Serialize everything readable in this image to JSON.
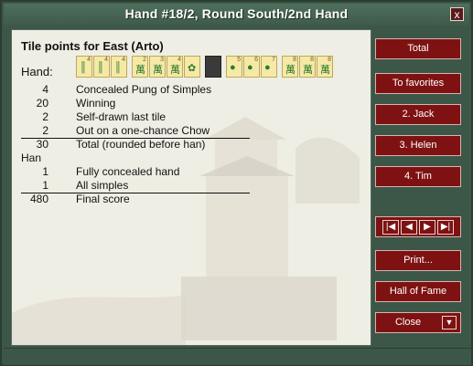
{
  "window": {
    "title": "Hand #18/2, Round South/2nd Hand",
    "close_glyph": "x"
  },
  "content": {
    "heading": "Tile points for East (Arto)",
    "hand_label": "Hand:",
    "tiles": [
      {
        "n": "4",
        "icon": "bamboo"
      },
      {
        "n": "4",
        "icon": "bamboo"
      },
      {
        "n": "4",
        "icon": "bamboo"
      },
      {
        "n": "2",
        "icon": "char"
      },
      {
        "n": "3",
        "icon": "char"
      },
      {
        "n": "4",
        "icon": "char"
      },
      {
        "n": "",
        "icon": "flower"
      },
      {
        "n": "",
        "icon": "dark"
      },
      {
        "n": "5",
        "icon": "circles"
      },
      {
        "n": "6",
        "icon": "circles"
      },
      {
        "n": "7",
        "icon": "circles"
      },
      {
        "n": "8",
        "icon": "char"
      },
      {
        "n": "8",
        "icon": "char"
      },
      {
        "n": "8",
        "icon": "char"
      }
    ],
    "scoring": [
      {
        "points": "4",
        "desc": "Concealed Pung of Simples"
      },
      {
        "points": "20",
        "desc": "Winning"
      },
      {
        "points": "2",
        "desc": "Self-drawn last tile"
      },
      {
        "points": "2",
        "desc": "Out on a one-chance Chow"
      }
    ],
    "total_row": {
      "points": "30",
      "desc": "Total (rounded before han)"
    },
    "han_label": "Han",
    "han_rows": [
      {
        "points": "1",
        "desc": "Fully concealed hand"
      },
      {
        "points": "1",
        "desc": "All simples"
      }
    ],
    "final_row": {
      "points": "480",
      "desc": "Final score"
    }
  },
  "buttons": {
    "total": "Total",
    "to_favorites": "To favorites",
    "jack": "2. Jack",
    "helen": "3. Helen",
    "tim": "4. Tim",
    "print": "Print...",
    "hall_of_fame": "Hall of Fame",
    "close": "Close"
  },
  "nav": {
    "first_glyph": "|◀",
    "prev_glyph": "◀",
    "next_glyph": "▶",
    "last_glyph": "▶|",
    "dropdown_glyph": "▼"
  }
}
